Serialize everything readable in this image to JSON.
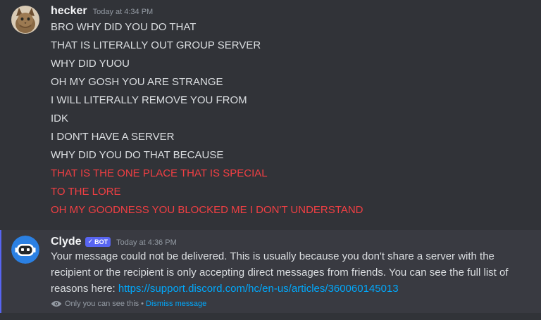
{
  "messages": {
    "hecker": {
      "username": "hecker",
      "timestamp": "Today at 4:34 PM",
      "lines": [
        "BRO WHY DID YOU DO THAT",
        "THAT IS LITERALLY OUT GROUP SERVER",
        "WHY DID YUOU",
        "OH MY GOSH YOU ARE STRANGE",
        "I WILL LITERALLY REMOVE YOU FROM",
        "IDK",
        "I DON'T HAVE A SERVER",
        "WHY DID YOU DO THAT BECAUSE",
        "THAT IS THE ONE PLACE THAT IS SPECIAL",
        "TO THE LORE",
        "OH MY GOODNESS YOU BLOCKED ME I DON'T UNDERSTAND"
      ],
      "failed_line_color": "#f23f43"
    },
    "clyde": {
      "username": "Clyde",
      "bot_tag": "BOT",
      "timestamp": "Today at 4:36 PM",
      "body": "Your message could not be delivered. This is usually because you don't share a server with the recipient or the recipient is only accepting direct messages from friends. You can see the full list of reasons here:",
      "link": "https://support.discord.com/hc/en-us/articles/360060145013",
      "ephemeral_note": "Only you can see this",
      "separator": "•",
      "dismiss_label": "Dismiss message",
      "accent_color": "#5865f2"
    }
  },
  "icons": {
    "hecker_avatar": "cat-photo-avatar",
    "clyde_avatar": "clyde-robot-avatar",
    "verified": "check-icon",
    "ephemeral": "eye-icon"
  }
}
